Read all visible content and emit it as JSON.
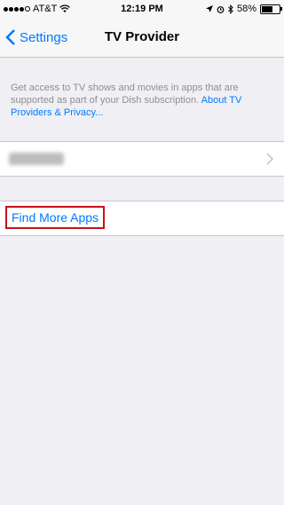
{
  "status_bar": {
    "carrier": "AT&T",
    "time": "12:19 PM",
    "battery_percent": "58%",
    "signal_bars": 4,
    "battery_level": 0.58
  },
  "nav": {
    "back_label": "Settings",
    "title": "TV Provider"
  },
  "info": {
    "text": "Get access to TV shows and movies in apps that are supported as part of your Dish subscription.",
    "link": "About TV Providers & Privacy..."
  },
  "find_more_apps": "Find More Apps",
  "colors": {
    "accent": "#007aff",
    "highlight": "#c4131a",
    "background": "#efeff4"
  }
}
